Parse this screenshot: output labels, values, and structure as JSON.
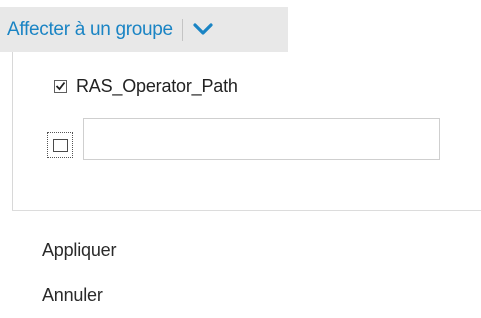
{
  "split_button": {
    "label": "Affecter à un groupe",
    "toggle_icon": "chevron-down-icon",
    "accent_color": "#1a84c4"
  },
  "groups": [
    {
      "label": "RAS_Operator_Path",
      "checked": true
    }
  ],
  "new_group": {
    "checked": false,
    "value": "",
    "placeholder": ""
  },
  "actions": {
    "apply_label": "Appliquer",
    "cancel_label": "Annuler"
  }
}
